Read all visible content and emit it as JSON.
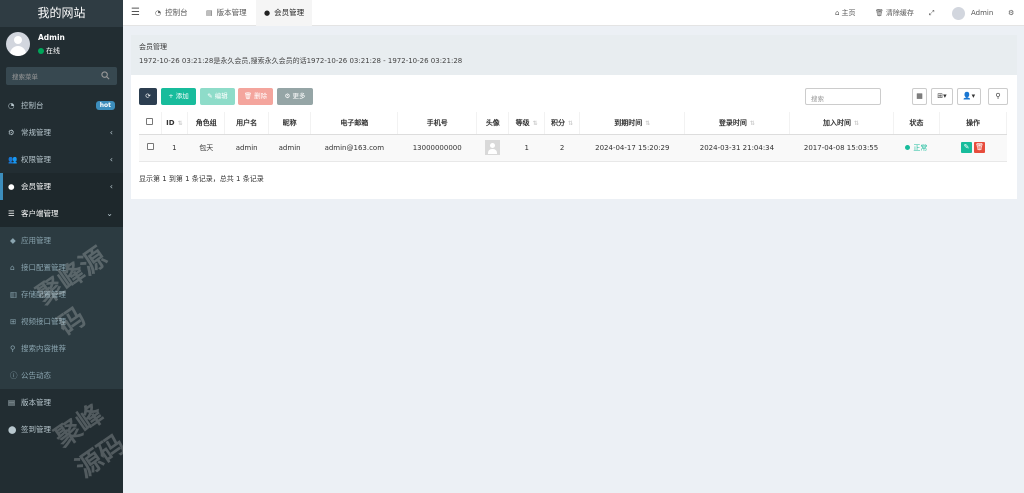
{
  "sidebar": {
    "site_title": "我的网站",
    "user_name": "Admin",
    "user_status": "在线",
    "search_placeholder": "搜索菜单",
    "items": [
      {
        "label": "控制台",
        "icon": "dashboard-icon",
        "badge": "hot"
      },
      {
        "label": "常规管理",
        "icon": "gears-icon"
      },
      {
        "label": "权限管理",
        "icon": "group-icon"
      },
      {
        "label": "会员管理",
        "icon": "user-circle-icon"
      },
      {
        "label": "客户端管理",
        "icon": "list-icon"
      },
      {
        "label": "应用管理",
        "icon": "diamond-icon"
      },
      {
        "label": "接口配置管理",
        "icon": "home-icon"
      },
      {
        "label": "存储配置管理",
        "icon": "bank-icon"
      },
      {
        "label": "视频接口管理",
        "icon": "sitemap-icon"
      },
      {
        "label": "搜索内容推荐",
        "icon": "search-icon"
      },
      {
        "label": "公告动态",
        "icon": "info-icon"
      },
      {
        "label": "版本管理",
        "icon": "file-icon"
      },
      {
        "label": "签到管理",
        "icon": "map-marker-icon"
      }
    ],
    "watermark": "聚峰源码"
  },
  "topbar": {
    "tabs": [
      {
        "label": "控制台",
        "icon": "dashboard-icon"
      },
      {
        "label": "版本管理",
        "icon": "file-icon"
      },
      {
        "label": "会员管理",
        "icon": "user-icon"
      }
    ],
    "home_label": "主页",
    "clear_cache_label": "清除缓存",
    "user_name": "Admin"
  },
  "panel": {
    "title": "会员管理",
    "description": "1972-10-26 03:21:28是永久会员,搜索永久会员的话1972-10-26 03:21:28 - 1972-10-26 03:21:28"
  },
  "toolbar": {
    "add_label": "添加",
    "edit_label": "编辑",
    "delete_label": "删除",
    "more_label": "更多",
    "search_placeholder": "搜索"
  },
  "table": {
    "headers": [
      "ID",
      "角色组",
      "用户名",
      "昵称",
      "电子邮箱",
      "手机号",
      "头像",
      "等级",
      "积分",
      "到期时间",
      "登录时间",
      "加入时间",
      "状态",
      "操作"
    ],
    "rows": [
      {
        "id": "1",
        "group": "包天",
        "username": "admin",
        "nickname": "admin",
        "email": "admin@163.com",
        "mobile": "13000000000",
        "level": "1",
        "score": "2",
        "expire_time": "2024-04-17 15:20:29",
        "login_time": "2024-03-31 21:04:34",
        "join_time": "2017-04-08 15:03:55",
        "status": "正常"
      }
    ],
    "footer": "显示第 1 到第 1 条记录，总共 1 条记录"
  },
  "colors": {
    "sidebar_bg": "#222d32",
    "accent": "#3c8dbc",
    "success": "#18bc9c",
    "danger": "#e74c3c"
  }
}
